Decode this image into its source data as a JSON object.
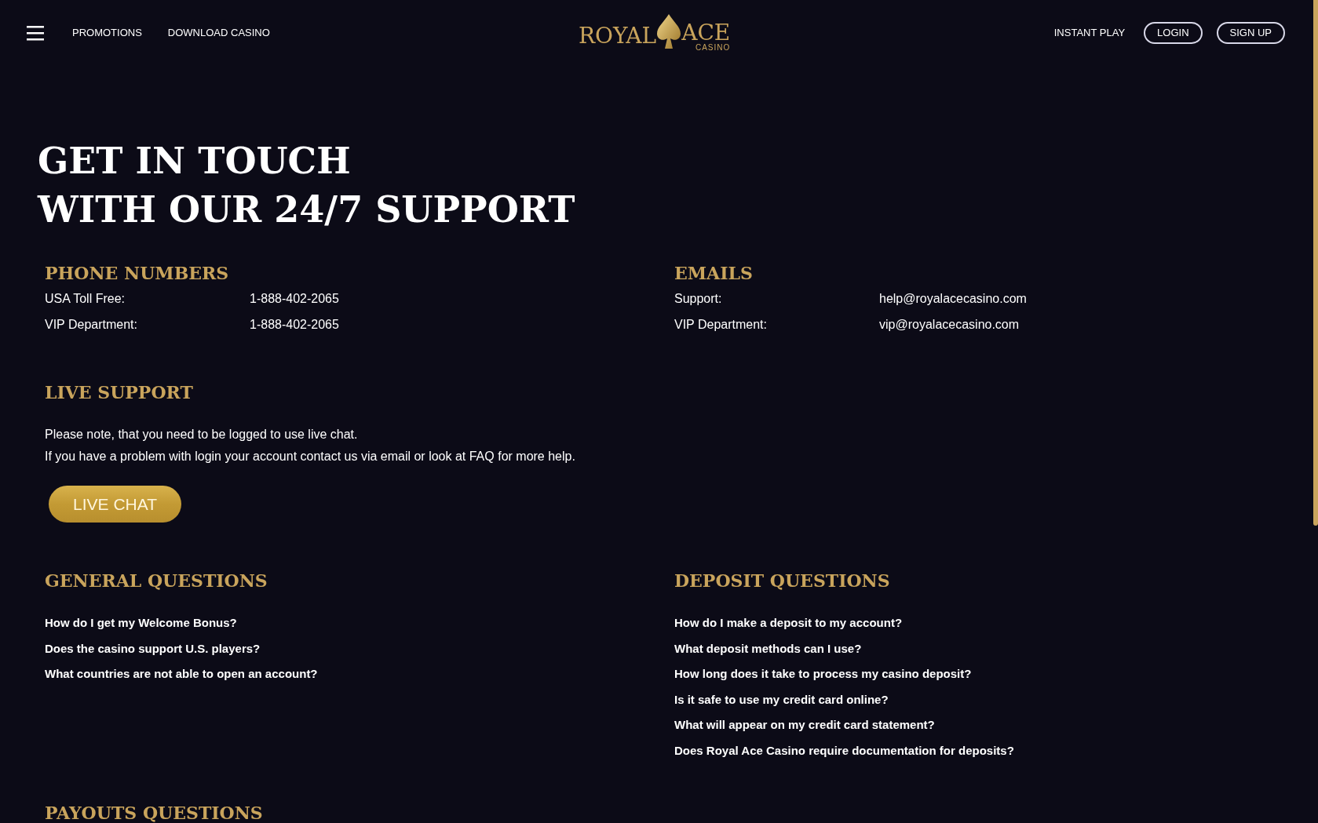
{
  "header": {
    "nav_links": [
      "PROMOTIONS",
      "DOWNLOAD CASINO"
    ],
    "logo": {
      "left": "ROYAL",
      "right": "ACE",
      "sub": "CASINO"
    },
    "actions": [
      {
        "label": "INSTANT PLAY",
        "kind": "link"
      },
      {
        "label": "LOGIN",
        "kind": "outline"
      },
      {
        "label": "SIGN UP",
        "kind": "outline"
      }
    ]
  },
  "headline": [
    "GET IN TOUCH",
    "WITH OUR 24/7 SUPPORT"
  ],
  "contacts": [
    {
      "title": "PHONE NUMBERS",
      "rows": [
        {
          "label": "USA Toll Free:",
          "value": "1-888-402-2065"
        },
        {
          "label": "VIP Department:",
          "value": "1-888-402-2065"
        }
      ]
    },
    {
      "title": "EMAILS",
      "rows": [
        {
          "label": "Support:",
          "value": "help@royalacecasino.com"
        },
        {
          "label": "VIP Department:",
          "value": "vip@royalacecasino.com"
        }
      ]
    }
  ],
  "live_support": {
    "title": "LIVE SUPPORT",
    "lines": [
      "Please note, that you need to be logged to use live chat.",
      "If you have a problem with login your account contact us via email or look at FAQ for more help."
    ],
    "button": "LIVE CHAT"
  },
  "faq": [
    {
      "title": "GENERAL QUESTIONS",
      "questions": [
        "How do I get my Welcome Bonus?",
        "Does the casino support U.S. players?",
        "What countries are not able to open an account?"
      ]
    },
    {
      "title": "DEPOSIT QUESTIONS",
      "questions": [
        "How do I make a deposit to my account?",
        "What deposit methods can I use?",
        "How long does it take to process my casino deposit?",
        "Is it safe to use my credit card online?",
        "What will appear on my credit card statement?",
        "Does Royal Ace Casino require documentation for deposits?"
      ]
    }
  ],
  "next_section": {
    "title": "PAYOUTS QUESTIONS"
  }
}
